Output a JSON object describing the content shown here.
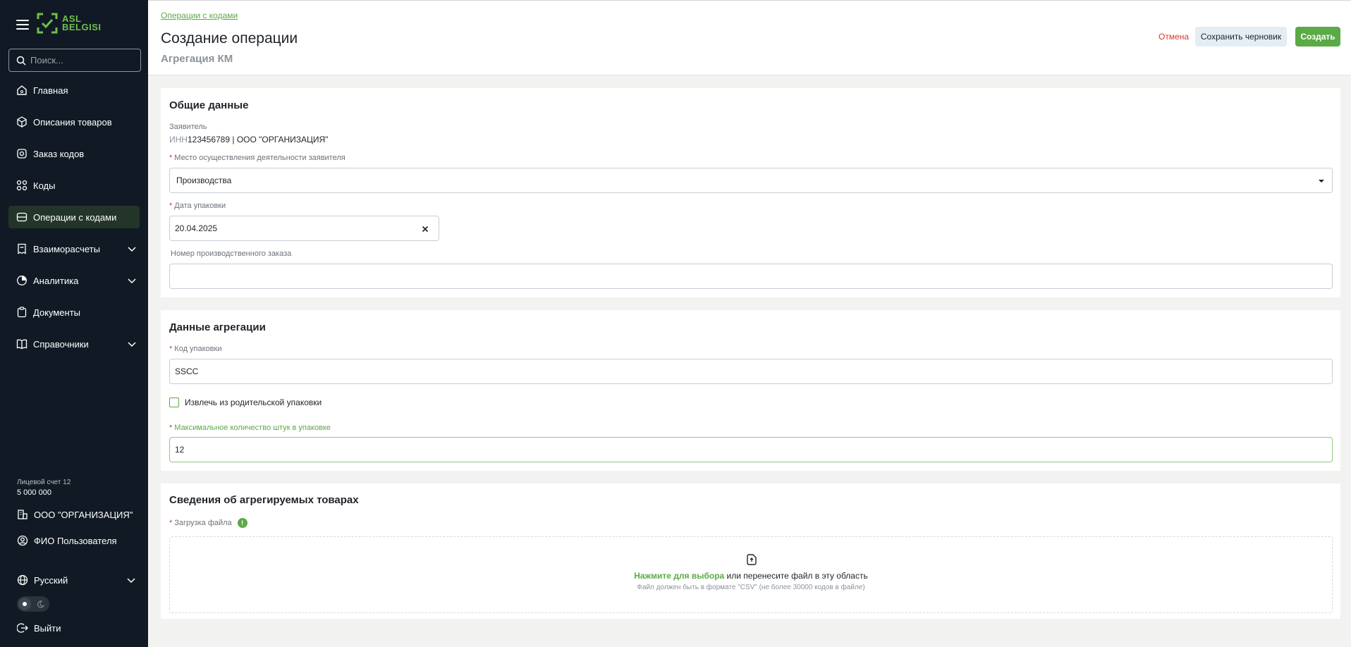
{
  "brand": {
    "logo_line1": "ASL",
    "logo_line2": "BELGISI"
  },
  "search": {
    "placeholder": "Поиск..."
  },
  "sidebar": {
    "items": [
      {
        "label": "Главная",
        "icon": "home-icon"
      },
      {
        "label": "Описания товаров",
        "icon": "box-icon"
      },
      {
        "label": "Заказ кодов",
        "icon": "code-order-icon"
      },
      {
        "label": "Коды",
        "icon": "codes-icon"
      },
      {
        "label": "Операции с кодами",
        "icon": "operations-icon",
        "active": true
      },
      {
        "label": "Взаиморасчеты",
        "icon": "receipt-icon",
        "expandable": true
      },
      {
        "label": "Аналитика",
        "icon": "analytics-icon",
        "expandable": true
      },
      {
        "label": "Документы",
        "icon": "documents-icon"
      },
      {
        "label": "Справочники",
        "icon": "book-icon",
        "expandable": true
      }
    ],
    "account_label": "Лицевой счет 12",
    "account_value": "5 000 000",
    "organization": "ООО \"ОРГАНИЗАЦИЯ\"",
    "user": "ФИО Пользователя",
    "language": "Русский",
    "logout": "Выйти"
  },
  "header": {
    "breadcrumb": "Операции с кодами",
    "title": "Создание операции",
    "subtitle": "Агрегация КМ",
    "cancel_label": "Отмена",
    "draft_label": "Сохранить черновик",
    "create_label": "Создать"
  },
  "general": {
    "title": "Общие данные",
    "applicant_label": "Заявитель",
    "inn_prefix": "ИНН",
    "applicant_value": "123456789 | ООО \"ОРГАНИЗАЦИЯ\"",
    "place_label": "Место осуществления деятельности заявителя",
    "place_value": "Производства",
    "date_label": "Дата упаковки",
    "date_value": "20.04.2025",
    "order_label": "Номер производственного заказа",
    "order_value": ""
  },
  "aggregation": {
    "title": "Данные агрегации",
    "code_label": "Код упаковки",
    "code_value": "SSCC",
    "extract_label": "Извлечь из родительской упаковки",
    "extract_checked": false,
    "max_label": "Максимальное количество штук в упаковке",
    "max_value": "12"
  },
  "goods": {
    "title": "Сведения об агрегируемых товарах",
    "upload_label": "Загрузка файла",
    "upload_link": "Нажмите для выбора",
    "upload_text": " или перенесите файл в эту область",
    "upload_hint": "Файл должен быть в формате \"CSV\" (не более 30000 кодов в файле)"
  },
  "colors": {
    "accent": "#5aaa46",
    "danger": "#d23a2e",
    "sidebar": "#111a24"
  }
}
